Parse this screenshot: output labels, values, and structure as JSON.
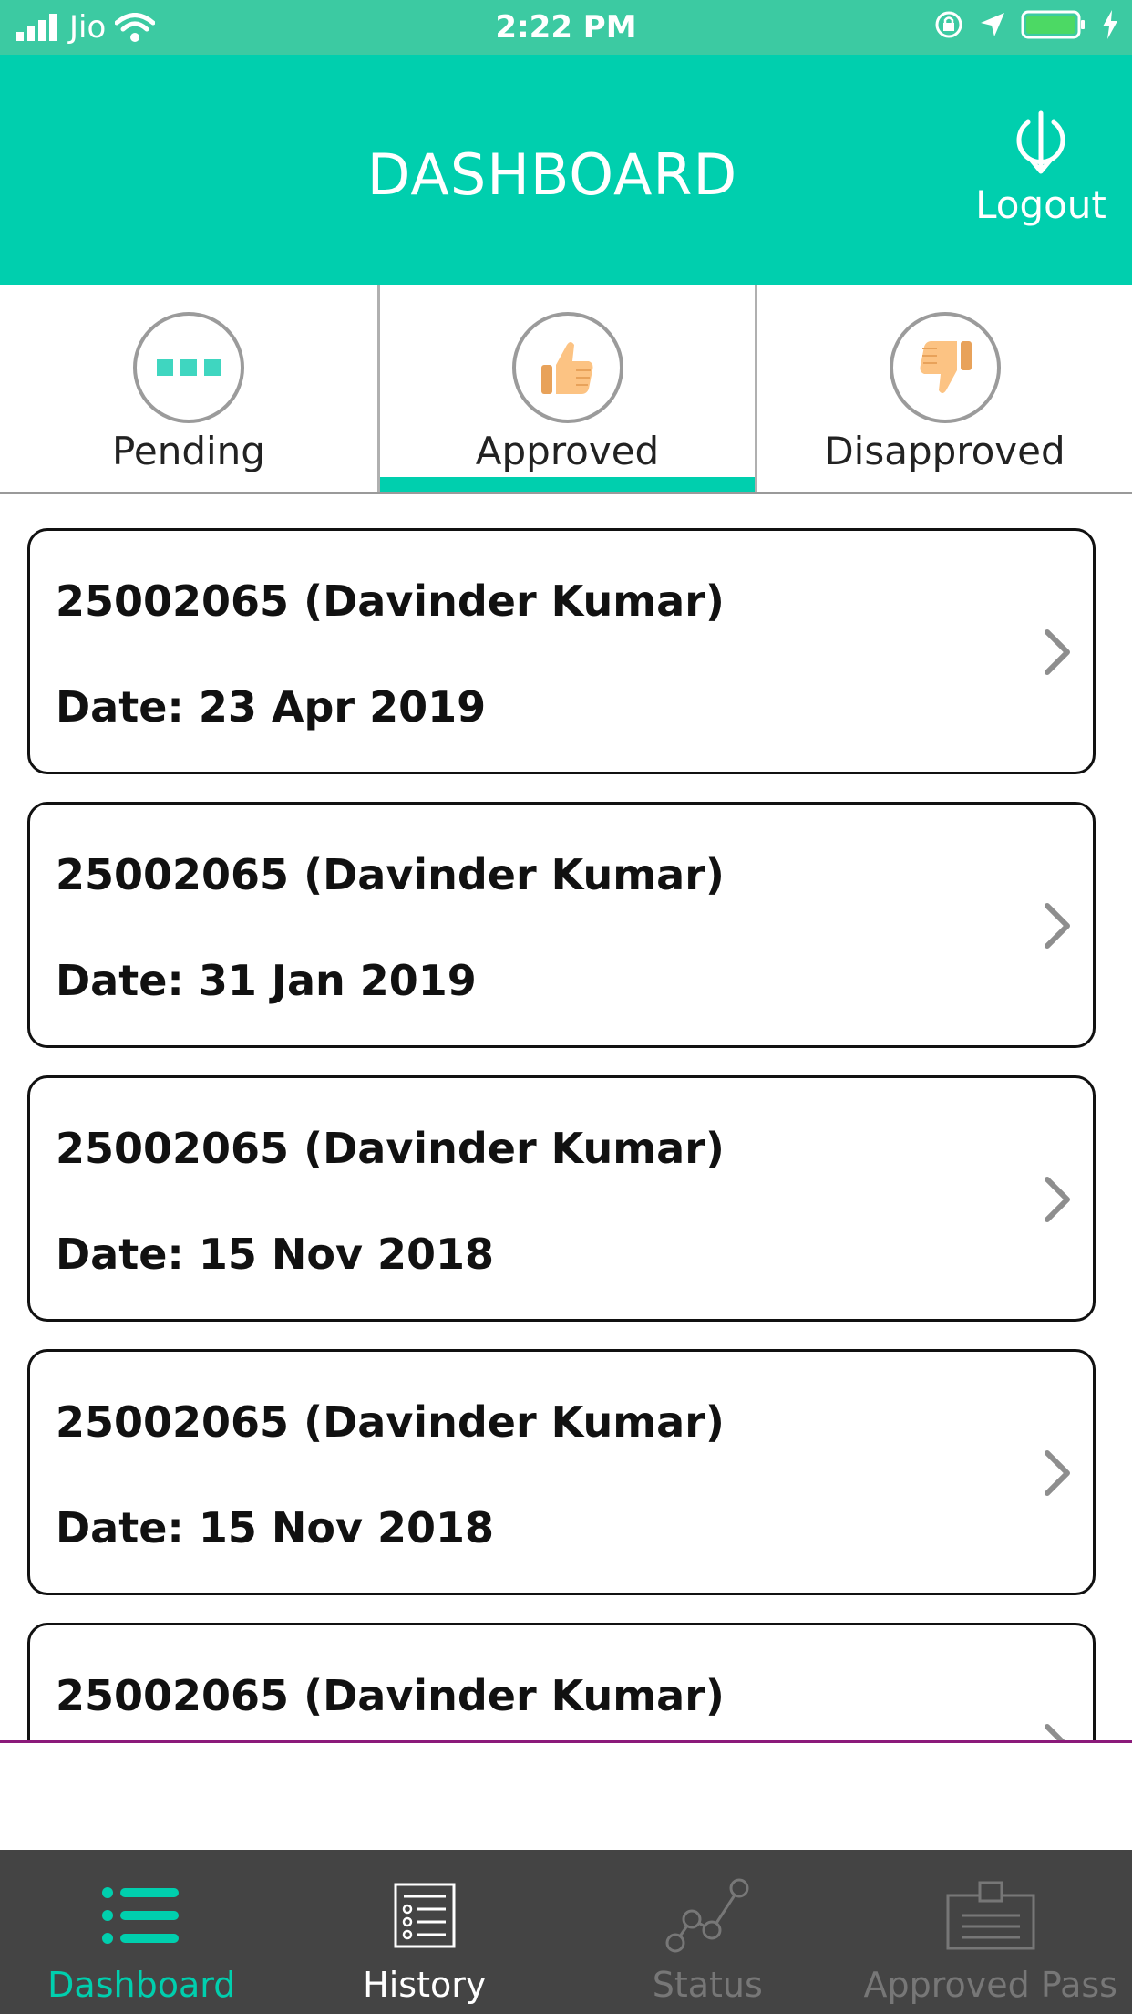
{
  "status_bar": {
    "carrier": "Jio",
    "time": "2:22 PM"
  },
  "header": {
    "title": "DASHBOARD",
    "logout_label": "Logout"
  },
  "tabs": [
    {
      "label": "Pending",
      "icon": "pending-dots-icon",
      "selected": false
    },
    {
      "label": "Approved",
      "icon": "thumbs-up-icon",
      "selected": true
    },
    {
      "label": "Disapproved",
      "icon": "thumbs-down-icon",
      "selected": false
    }
  ],
  "cards": [
    {
      "title": "25002065 (Davinder Kumar)",
      "date": "Date: 23 Apr 2019"
    },
    {
      "title": "25002065 (Davinder Kumar)",
      "date": "Date: 31 Jan 2019"
    },
    {
      "title": "25002065 (Davinder Kumar)",
      "date": "Date: 15 Nov 2018"
    },
    {
      "title": "25002065 (Davinder Kumar)",
      "date": "Date: 15 Nov 2018"
    },
    {
      "title": "25002065 (Davinder Kumar)",
      "date": ""
    }
  ],
  "bottom_nav": [
    {
      "label": "Dashboard",
      "icon": "list-icon",
      "state": "active"
    },
    {
      "label": "History",
      "icon": "checklist-icon",
      "state": "normal"
    },
    {
      "label": "Status",
      "icon": "graph-icon",
      "state": "dim"
    },
    {
      "label": "Approved Pass",
      "icon": "id-card-icon",
      "state": "dim"
    }
  ],
  "colors": {
    "primary": "#00cfae",
    "status_bar": "#3ccaa2",
    "nav_bg": "#444444",
    "nav_active": "#00cfae",
    "nav_normal": "#ffffff",
    "nav_dim": "#777777"
  }
}
